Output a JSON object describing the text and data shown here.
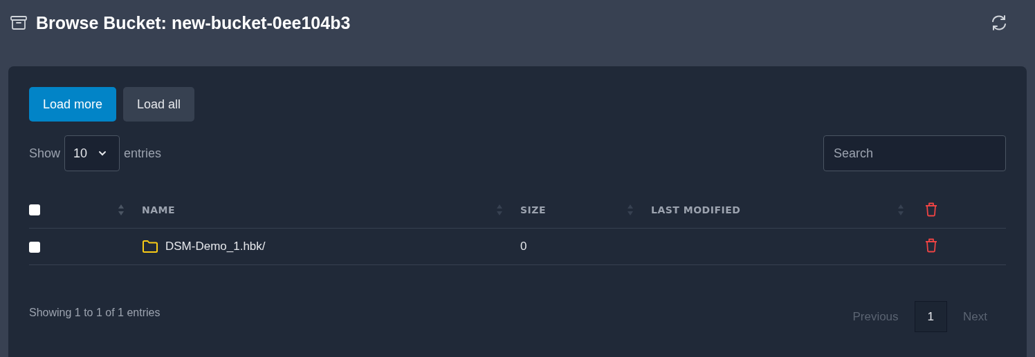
{
  "header": {
    "title": "Browse Bucket: new-bucket-0ee104b3"
  },
  "actions": [
    {
      "label": "Load more",
      "kind": "primary"
    },
    {
      "label": "Load all",
      "kind": "secondary"
    }
  ],
  "length": {
    "before": "Show",
    "value": "10",
    "after": "entries"
  },
  "search": {
    "placeholder": "Search"
  },
  "table": {
    "select_all": {
      "checked": false
    },
    "columns": [
      {
        "label": "NAME"
      },
      {
        "label": "SIZE"
      },
      {
        "label": "LAST MODIFIED"
      }
    ],
    "rows": [
      {
        "checked": false,
        "kind": "folder",
        "name": "DSM-Demo_1.hbk/",
        "size": "0"
      }
    ]
  },
  "info": "Showing 1 to 1 of 1 entries",
  "pagination": [
    {
      "label": "Previous",
      "kind": "nav",
      "disabled": true,
      "selected": false
    },
    {
      "label": "1",
      "kind": "page",
      "disabled": false,
      "selected": true
    },
    {
      "label": "Next",
      "kind": "nav",
      "disabled": true,
      "selected": false
    }
  ]
}
